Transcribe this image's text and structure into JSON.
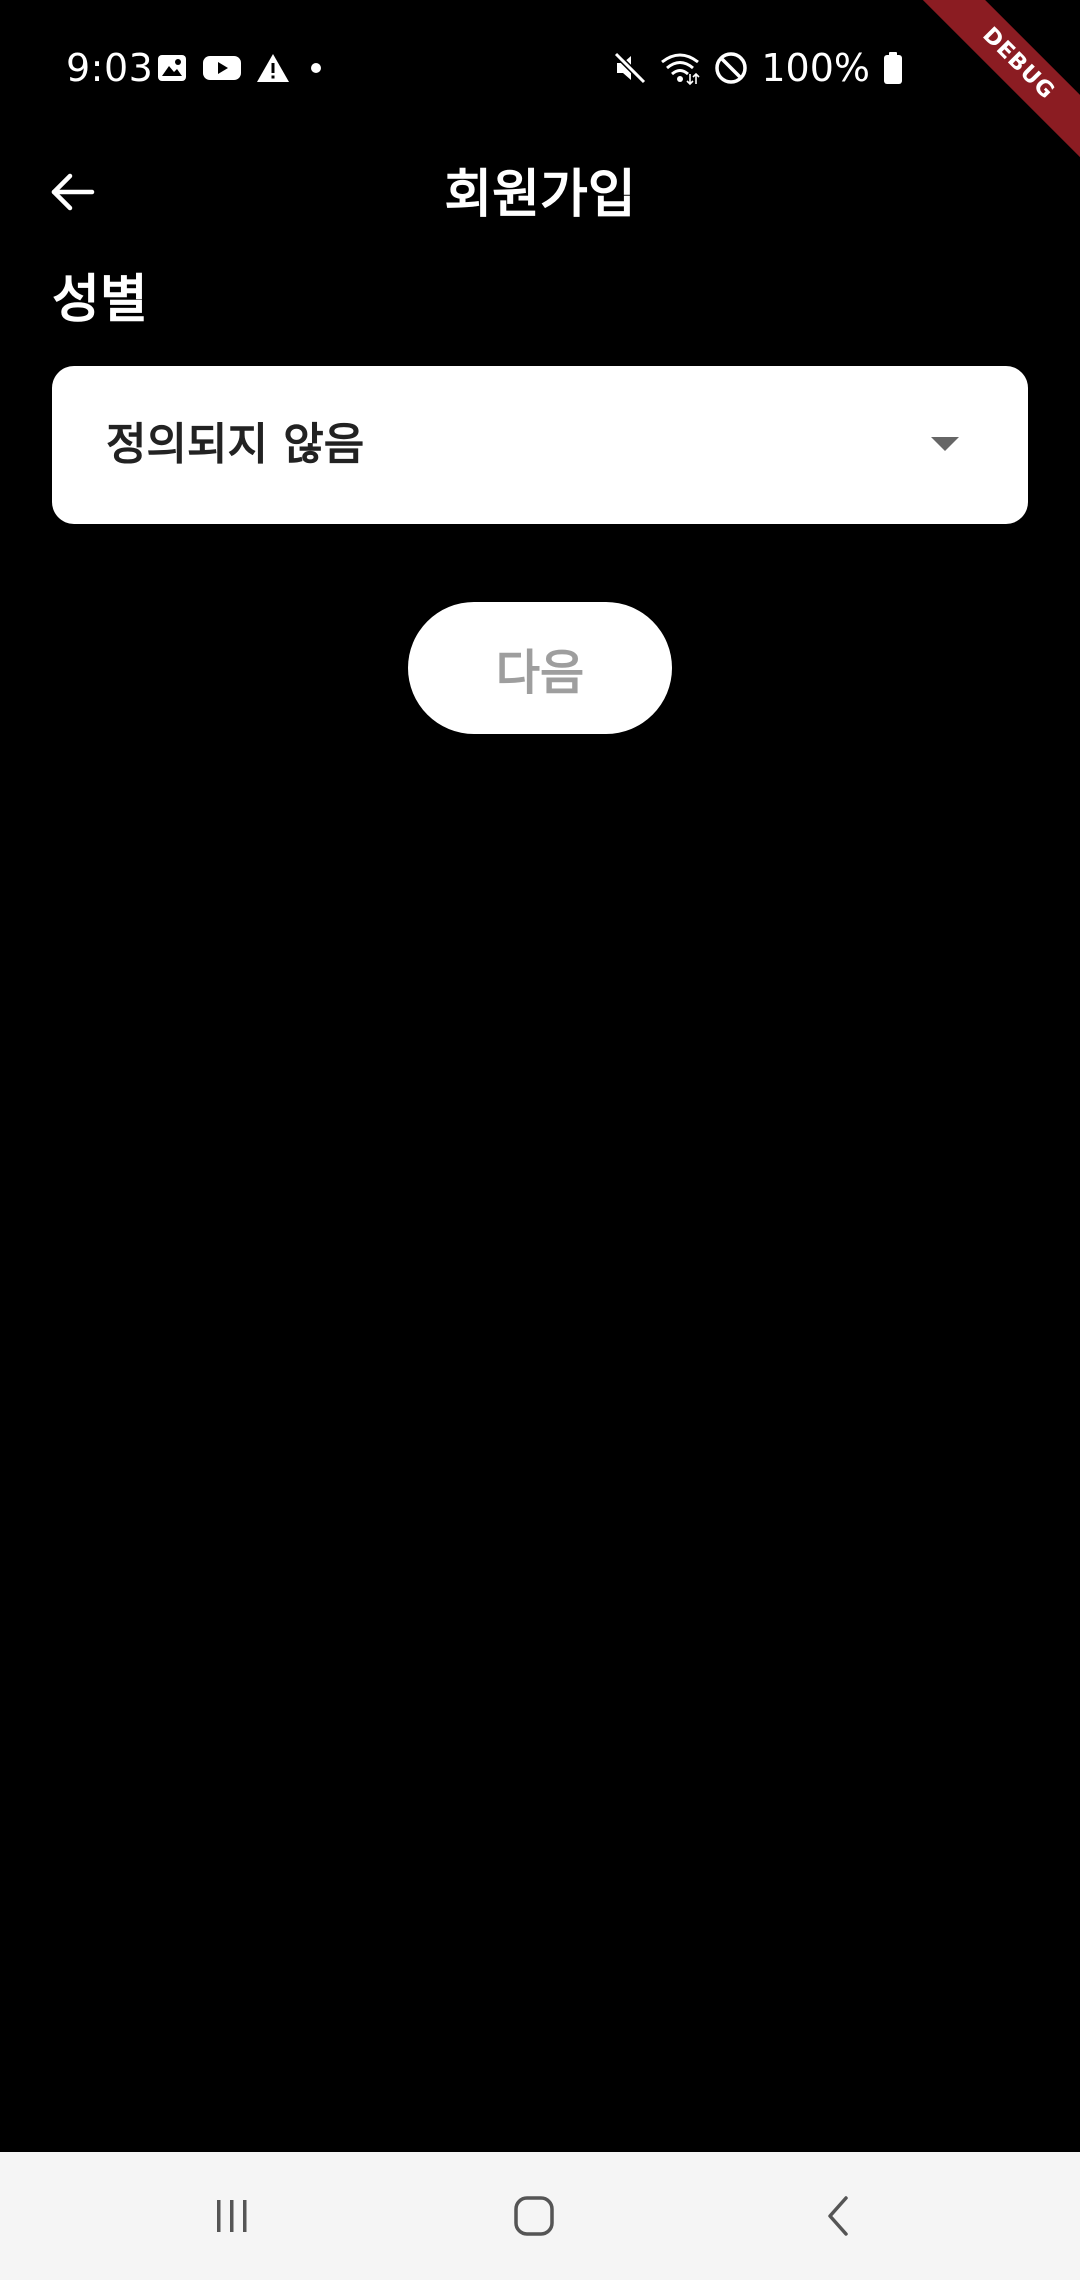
{
  "status_bar": {
    "time": "9:03",
    "battery": "100%",
    "left_icons": [
      "image-icon",
      "youtube-icon",
      "warning-icon",
      "dot-icon"
    ],
    "right_icons": [
      "mute-icon",
      "wifi-icon",
      "do-not-disturb-icon",
      "battery-icon"
    ]
  },
  "debug_banner": "DEBUG",
  "app_bar": {
    "title": "회원가입",
    "back_icon": "arrow-left-icon"
  },
  "gender": {
    "label": "성별",
    "selected": "정의되지 않음",
    "arrow_icon": "dropdown-arrow-icon"
  },
  "next_button": {
    "label": "다음"
  },
  "nav_bar": {
    "buttons": [
      "recents-icon",
      "home-icon",
      "back-icon"
    ]
  },
  "colors": {
    "background": "#000000",
    "surface": "#ffffff",
    "disabled_text": "#9e9e9e",
    "debug_ribbon": "#8b1c22",
    "nav_bar": "#f5f5f5"
  }
}
